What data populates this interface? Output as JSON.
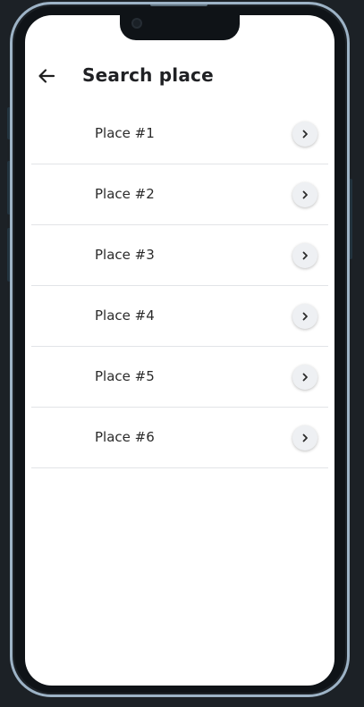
{
  "header": {
    "title": "Search place",
    "back_icon": "arrow-left-icon"
  },
  "places": [
    {
      "label": "Place #1",
      "icon": "chevron-right-icon"
    },
    {
      "label": "Place #2",
      "icon": "chevron-right-icon"
    },
    {
      "label": "Place #3",
      "icon": "chevron-right-icon"
    },
    {
      "label": "Place #4",
      "icon": "chevron-right-icon"
    },
    {
      "label": "Place #5",
      "icon": "chevron-right-icon"
    },
    {
      "label": "Place #6",
      "icon": "chevron-right-icon"
    }
  ],
  "colors": {
    "background": "#1c2126",
    "frame": "#9db3c6",
    "screen": "#ffffff",
    "text": "#202124",
    "divider": "#e2e4e7"
  }
}
